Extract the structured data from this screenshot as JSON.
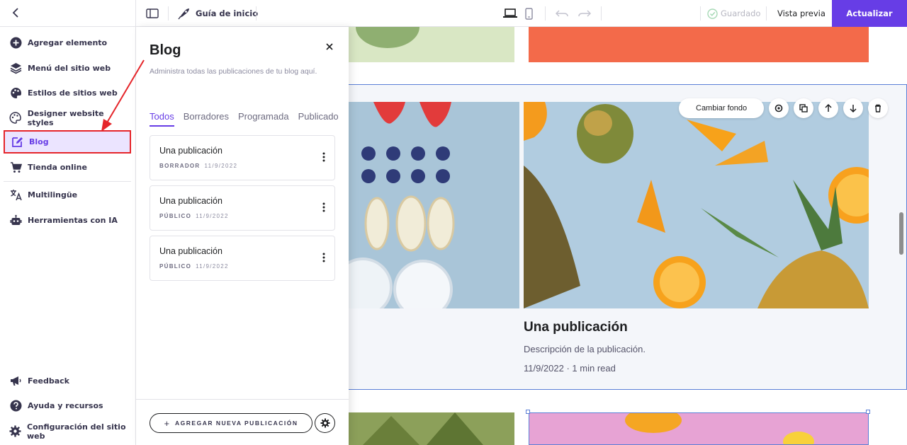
{
  "topbar": {
    "guide_label": "Guía de inicio",
    "saved_label": "Guardado",
    "preview_label": "Vista previa",
    "update_label": "Actualizar"
  },
  "sidebar": {
    "items": [
      {
        "label": "Agregar elemento",
        "icon": "plus-circle-icon"
      },
      {
        "label": "Menú del sitio web",
        "icon": "layers-icon"
      },
      {
        "label": "Estilos de sitios web",
        "icon": "palette-icon"
      },
      {
        "label": "Designer website styles",
        "icon": "palette-outline-icon"
      },
      {
        "label": "Blog",
        "icon": "edit-icon",
        "active": true
      },
      {
        "label": "Tienda online",
        "icon": "cart-icon"
      },
      {
        "label": "Multilingüe",
        "icon": "translate-icon"
      },
      {
        "label": "Herramientas con IA",
        "icon": "robot-icon"
      }
    ],
    "bottom_items": [
      {
        "label": "Feedback",
        "icon": "megaphone-icon"
      },
      {
        "label": "Ayuda y recursos",
        "icon": "help-icon"
      },
      {
        "label": "Configuración del sitio web",
        "icon": "gear-icon"
      }
    ]
  },
  "blog_panel": {
    "title": "Blog",
    "description": "Administra todas las publicaciones de tu blog aquí.",
    "tabs": [
      "Todos",
      "Borradores",
      "Programada",
      "Publicado"
    ],
    "posts": [
      {
        "title": "Una publicación",
        "status": "BORRADOR",
        "date": "11/9/2022"
      },
      {
        "title": "Una publicación",
        "status": "PÚBLICO",
        "date": "11/9/2022"
      },
      {
        "title": "Una publicación",
        "status": "PÚBLICO",
        "date": "11/9/2022"
      }
    ],
    "add_post_label": "AGREGAR NUEVA PUBLICACIÓN"
  },
  "canvas": {
    "change_bg_label": "Cambiar fondo",
    "post_heading": "Una publicación",
    "post_description": "Descripción de la publicación.",
    "post_date": "11/9/2022 · 1 min read"
  },
  "colors": {
    "accent": "#673de6",
    "annotation": "#e5252a",
    "selection": "#5b7fd6"
  }
}
